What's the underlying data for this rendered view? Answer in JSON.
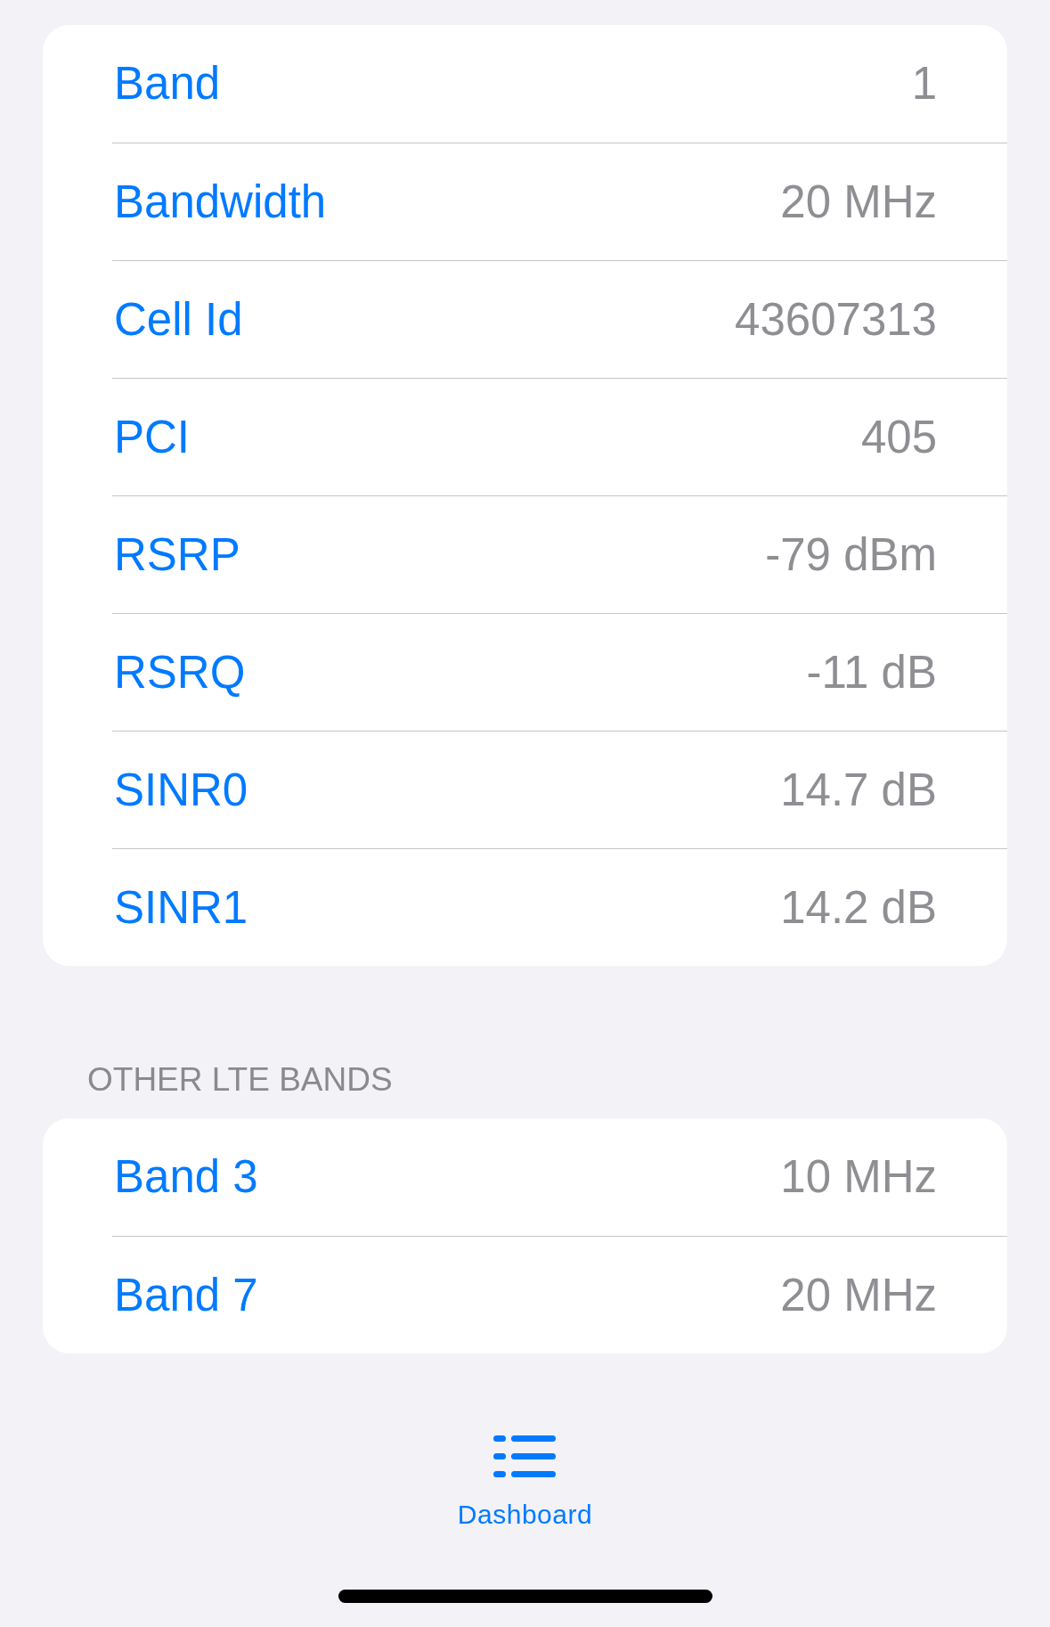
{
  "sections": [
    {
      "rows": [
        {
          "label": "Band",
          "value": "1"
        },
        {
          "label": "Bandwidth",
          "value": "20 MHz"
        },
        {
          "label": "Cell Id",
          "value": "43607313"
        },
        {
          "label": "PCI",
          "value": "405"
        },
        {
          "label": "RSRP",
          "value": "-79 dBm"
        },
        {
          "label": "RSRQ",
          "value": "-11 dB"
        },
        {
          "label": "SINR0",
          "value": "14.7 dB"
        },
        {
          "label": "SINR1",
          "value": "14.2 dB"
        }
      ]
    },
    {
      "header": "OTHER LTE BANDS",
      "rows": [
        {
          "label": "Band 3",
          "value": "10 MHz"
        },
        {
          "label": "Band 7",
          "value": "20 MHz"
        }
      ]
    }
  ],
  "tab_bar": {
    "items": [
      {
        "label": "Dashboard",
        "selected": true
      }
    ]
  }
}
